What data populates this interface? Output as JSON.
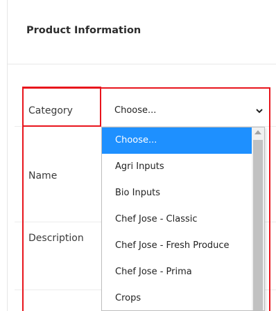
{
  "card": {
    "title": "Product Information"
  },
  "form": {
    "labels": {
      "category": "Category",
      "name": "Name",
      "description": "Description"
    },
    "category_select": {
      "value": "Choose..."
    }
  },
  "dropdown": {
    "options": [
      "Choose...",
      "Agri Inputs",
      "Bio Inputs",
      "Chef Jose - Classic",
      "Chef Jose - Fresh Produce",
      "Chef Jose - Prima",
      "Crops"
    ],
    "selected_index": 0
  },
  "colors": {
    "highlight": "#e8141c",
    "selected_option": "#1e90ff"
  },
  "icons": {
    "select_arrow": "chevron-down-icon",
    "scroll_up": "scroll-up-arrow-icon"
  }
}
